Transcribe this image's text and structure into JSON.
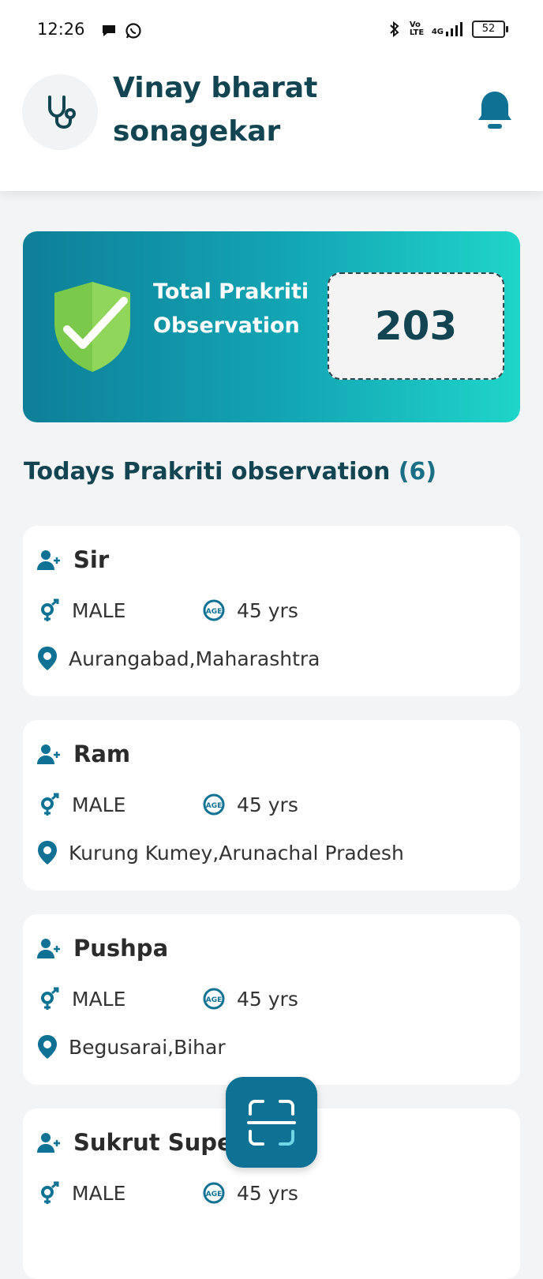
{
  "status_bar": {
    "time": "12:26",
    "network": "4G",
    "volte": "Vo LTE",
    "battery": "52"
  },
  "header": {
    "user_name": "Vinay bharat sonagekar",
    "avatar_icon": "stethoscope-icon",
    "notification_icon": "bell-icon"
  },
  "summary": {
    "label": "Total Prakriti Observation",
    "count": "203",
    "icon": "shield-check-icon"
  },
  "section": {
    "title": "Todays Prakriti observation",
    "count": "(6)"
  },
  "observations": [
    {
      "name": "Sir",
      "gender": "MALE",
      "age": "45 yrs",
      "location": "Aurangabad,Maharashtra"
    },
    {
      "name": "Ram",
      "gender": "MALE",
      "age": "45 yrs",
      "location": "Kurung Kumey,Arunachal Pradesh"
    },
    {
      "name": "Pushpa",
      "gender": "MALE",
      "age": "45 yrs",
      "location": "Begusarai,Bihar"
    },
    {
      "name": "Sukrut Supe",
      "gender": "MALE",
      "age": "45 yrs",
      "location": ""
    }
  ],
  "colors": {
    "primary": "#124452",
    "accent": "#0f7294",
    "gradient_start": "#0e7f98",
    "gradient_end": "#1fd5c9",
    "shield": "#7bc94a"
  },
  "fab_icon": "scan-icon"
}
